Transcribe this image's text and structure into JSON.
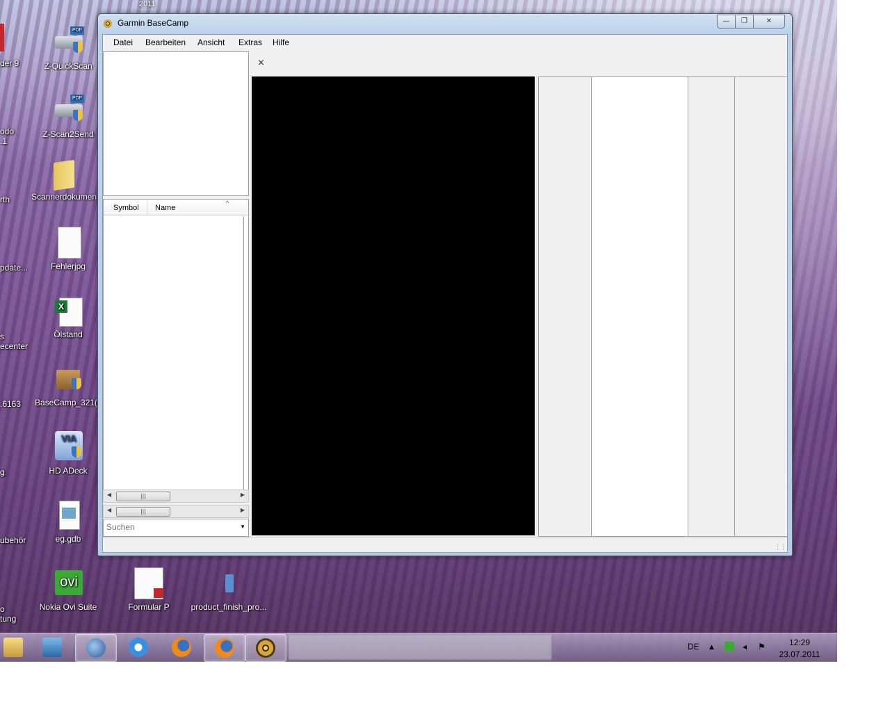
{
  "desktop": {
    "top_label": "2011",
    "icons": [
      {
        "label": "Z-QuickScan"
      },
      {
        "label": "Z-Scan2Send"
      },
      {
        "label": "Scannerdokumen"
      },
      {
        "label": "Fehlerjpg"
      },
      {
        "label": "Ölstand"
      },
      {
        "label": "BaseCamp_321(2"
      },
      {
        "label": "HD ADeck"
      },
      {
        "label": "eg.gdb"
      },
      {
        "label": "Nokia Ovi Suite"
      },
      {
        "label": "Formular P"
      },
      {
        "label": "product_finish_pro..."
      }
    ],
    "edge_labels": [
      "der 9",
      "odo",
      ".1",
      "rth",
      "pdate...",
      "s",
      "ecenter",
      ".6163",
      "g",
      "ubehör",
      "o",
      "tung"
    ]
  },
  "window": {
    "title": "Garmin BaseCamp",
    "menu": [
      "Datei",
      "Bearbeiten",
      "Ansicht",
      "Extras",
      "Hilfe"
    ],
    "list_columns": [
      "Symbol",
      "Name"
    ],
    "search_placeholder": "Suchen",
    "tab_close": "×"
  },
  "taskbar": {
    "language": "DE",
    "time": "12:29",
    "date": "23.07.2011"
  }
}
